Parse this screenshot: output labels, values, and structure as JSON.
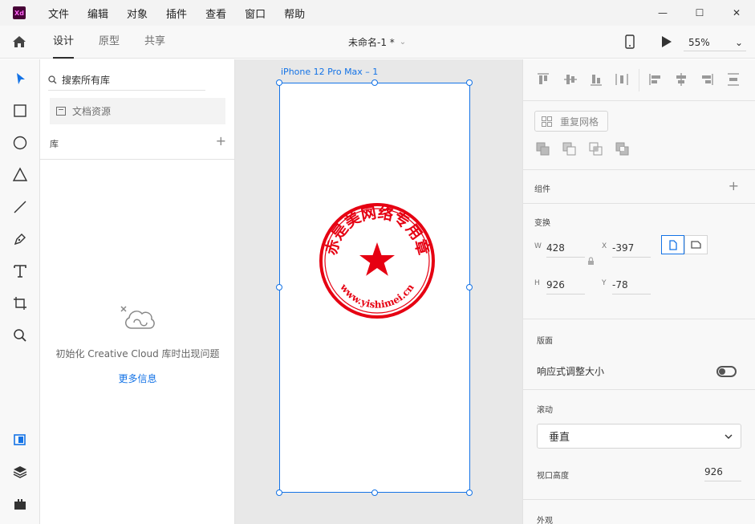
{
  "app": {
    "logo": "Xd"
  },
  "menu": [
    "文件",
    "编辑",
    "对象",
    "插件",
    "查看",
    "窗口",
    "帮助"
  ],
  "window_controls": {
    "minimize": "—",
    "maximize": "☐",
    "close": "✕"
  },
  "tabs": [
    {
      "label": "设计",
      "active": true
    },
    {
      "label": "原型",
      "active": false
    },
    {
      "label": "共享",
      "active": false
    }
  ],
  "document": {
    "title": "未命名-1 *"
  },
  "zoom": {
    "value": "55%"
  },
  "tools": [
    "select-icon",
    "rectangle-icon",
    "ellipse-icon",
    "triangle-icon",
    "line-icon",
    "pen-icon",
    "text-icon",
    "artboard-icon",
    "zoom-icon"
  ],
  "libraries": {
    "search_placeholder": "搜索所有库",
    "doc_assets": "文档资源",
    "header": "库",
    "cc_message": "初始化 Creative Cloud 库时出现问题",
    "cc_link": "更多信息"
  },
  "canvas": {
    "artboard_name": "iPhone 12 Pro Max – 1",
    "seal": {
      "top_text": "赤是美网络专用章",
      "bottom_text": "www.yishimei.cn",
      "color": "#e60012"
    }
  },
  "properties": {
    "repeat_grid": "重复网格",
    "component_label": "组件",
    "transform_label": "变换",
    "w_label": "W",
    "w_value": "428",
    "x_label": "X",
    "x_value": "-397",
    "h_label": "H",
    "h_value": "926",
    "y_label": "Y",
    "y_value": "-78",
    "layout_label": "版面",
    "responsive_label": "响应式调整大小",
    "scroll_label": "滚动",
    "scroll_value": "垂直",
    "viewport_label": "视口高度",
    "viewport_value": "926",
    "appearance_label": "外观"
  },
  "colors": {
    "accent": "#1473e6",
    "seal_red": "#e60012"
  }
}
